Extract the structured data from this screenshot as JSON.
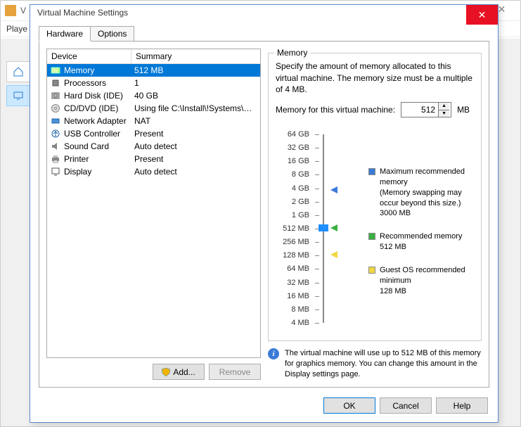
{
  "bg": {
    "title_partial": "V",
    "toolbar_partial": "Playe"
  },
  "dialog": {
    "title": "Virtual Machine Settings",
    "tabs": {
      "hardware": "Hardware",
      "options": "Options"
    },
    "columns": {
      "device": "Device",
      "summary": "Summary"
    },
    "devices": [
      {
        "name": "Memory",
        "summary": "512 MB",
        "icon": "memory"
      },
      {
        "name": "Processors",
        "summary": "1",
        "icon": "cpu"
      },
      {
        "name": "Hard Disk (IDE)",
        "summary": "40 GB",
        "icon": "hdd"
      },
      {
        "name": "CD/DVD (IDE)",
        "summary": "Using file C:\\Install\\!Systems\\MyH...",
        "icon": "cd"
      },
      {
        "name": "Network Adapter",
        "summary": "NAT",
        "icon": "nic"
      },
      {
        "name": "USB Controller",
        "summary": "Present",
        "icon": "usb"
      },
      {
        "name": "Sound Card",
        "summary": "Auto detect",
        "icon": "sound"
      },
      {
        "name": "Printer",
        "summary": "Present",
        "icon": "printer"
      },
      {
        "name": "Display",
        "summary": "Auto detect",
        "icon": "display"
      }
    ],
    "buttons": {
      "add": "Add...",
      "remove": "Remove",
      "ok": "OK",
      "cancel": "Cancel",
      "help": "Help"
    }
  },
  "memory": {
    "group_title": "Memory",
    "desc": "Specify the amount of memory allocated to this virtual machine. The memory size must be a multiple of 4 MB.",
    "label": "Memory for this virtual machine:",
    "value": "512",
    "unit": "MB",
    "scale": [
      "64 GB",
      "32 GB",
      "16 GB",
      "8 GB",
      "4 GB",
      "2 GB",
      "1 GB",
      "512 MB",
      "256 MB",
      "128 MB",
      "64 MB",
      "32 MB",
      "16 MB",
      "8 MB",
      "4 MB"
    ],
    "legend": {
      "max": {
        "label": "Maximum recommended memory",
        "note": "(Memory swapping may occur beyond this size.)",
        "value": "3000 MB"
      },
      "rec": {
        "label": "Recommended memory",
        "value": "512 MB"
      },
      "min": {
        "label": "Guest OS recommended minimum",
        "value": "128 MB"
      }
    },
    "info": "The virtual machine will use up to 512 MB of this memory for graphics memory. You can change this amount in the Display settings page."
  }
}
